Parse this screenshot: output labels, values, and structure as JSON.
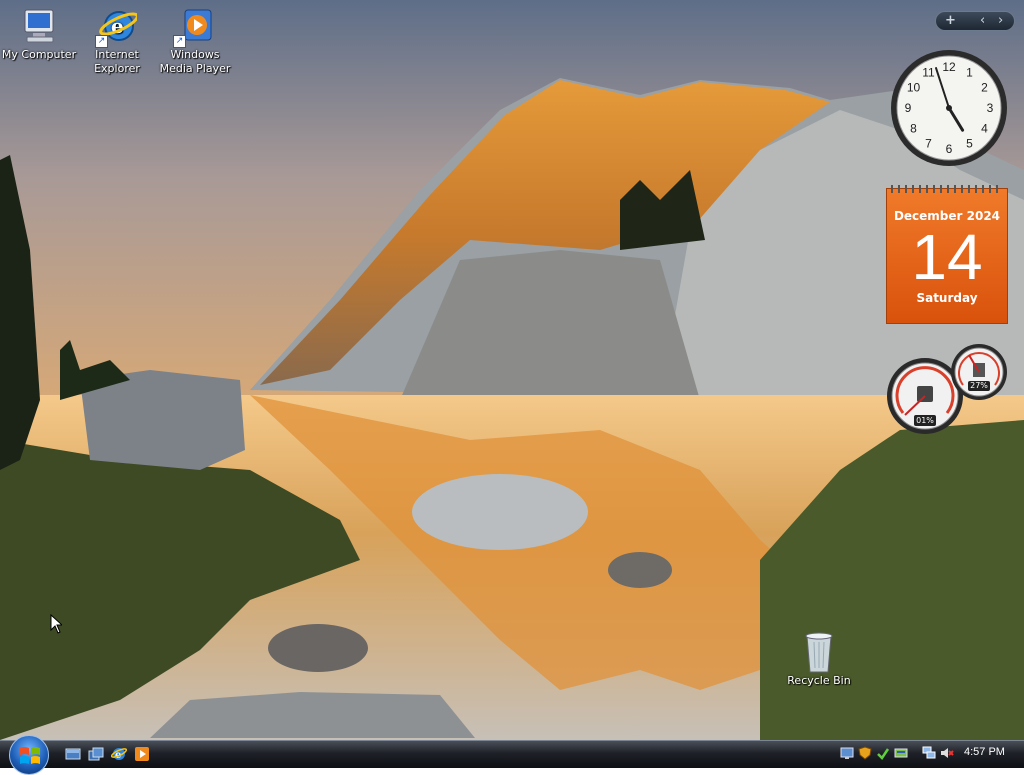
{
  "desktop": {
    "icons": [
      {
        "label_line1": "My Computer",
        "label_line2": "",
        "icon": "computer-icon"
      },
      {
        "label_line1": "Internet",
        "label_line2": "Explorer",
        "icon": "internet-explorer-icon"
      },
      {
        "label_line1": "Windows",
        "label_line2": "Media Player",
        "icon": "media-player-icon"
      }
    ],
    "recycle_bin": {
      "label": "Recycle Bin",
      "icon": "recycle-bin-icon"
    }
  },
  "sidebar": {
    "add_gadget": "+",
    "prev": "‹",
    "next": "›",
    "clock": {
      "hour": 4,
      "minute": 57
    },
    "calendar": {
      "month_year": "December 2024",
      "day": "14",
      "weekday": "Saturday"
    },
    "meters": {
      "cpu_percent": "01%",
      "memory_percent": "27%"
    }
  },
  "taskbar": {
    "start_icon": "windows-logo-icon",
    "quick_launch": [
      "show-desktop-icon",
      "switch-windows-icon",
      "internet-explorer-icon",
      "media-player-icon"
    ],
    "tray_icons": [
      "network-icon",
      "security-icon",
      "update-icon",
      "drive-icon",
      "monitor-icon",
      "volume-muted-icon"
    ],
    "time": "4:57 PM"
  },
  "colors": {
    "calendar": "#e2621a",
    "taskbar": "#1e2128",
    "accent": "#1f5fb8"
  }
}
